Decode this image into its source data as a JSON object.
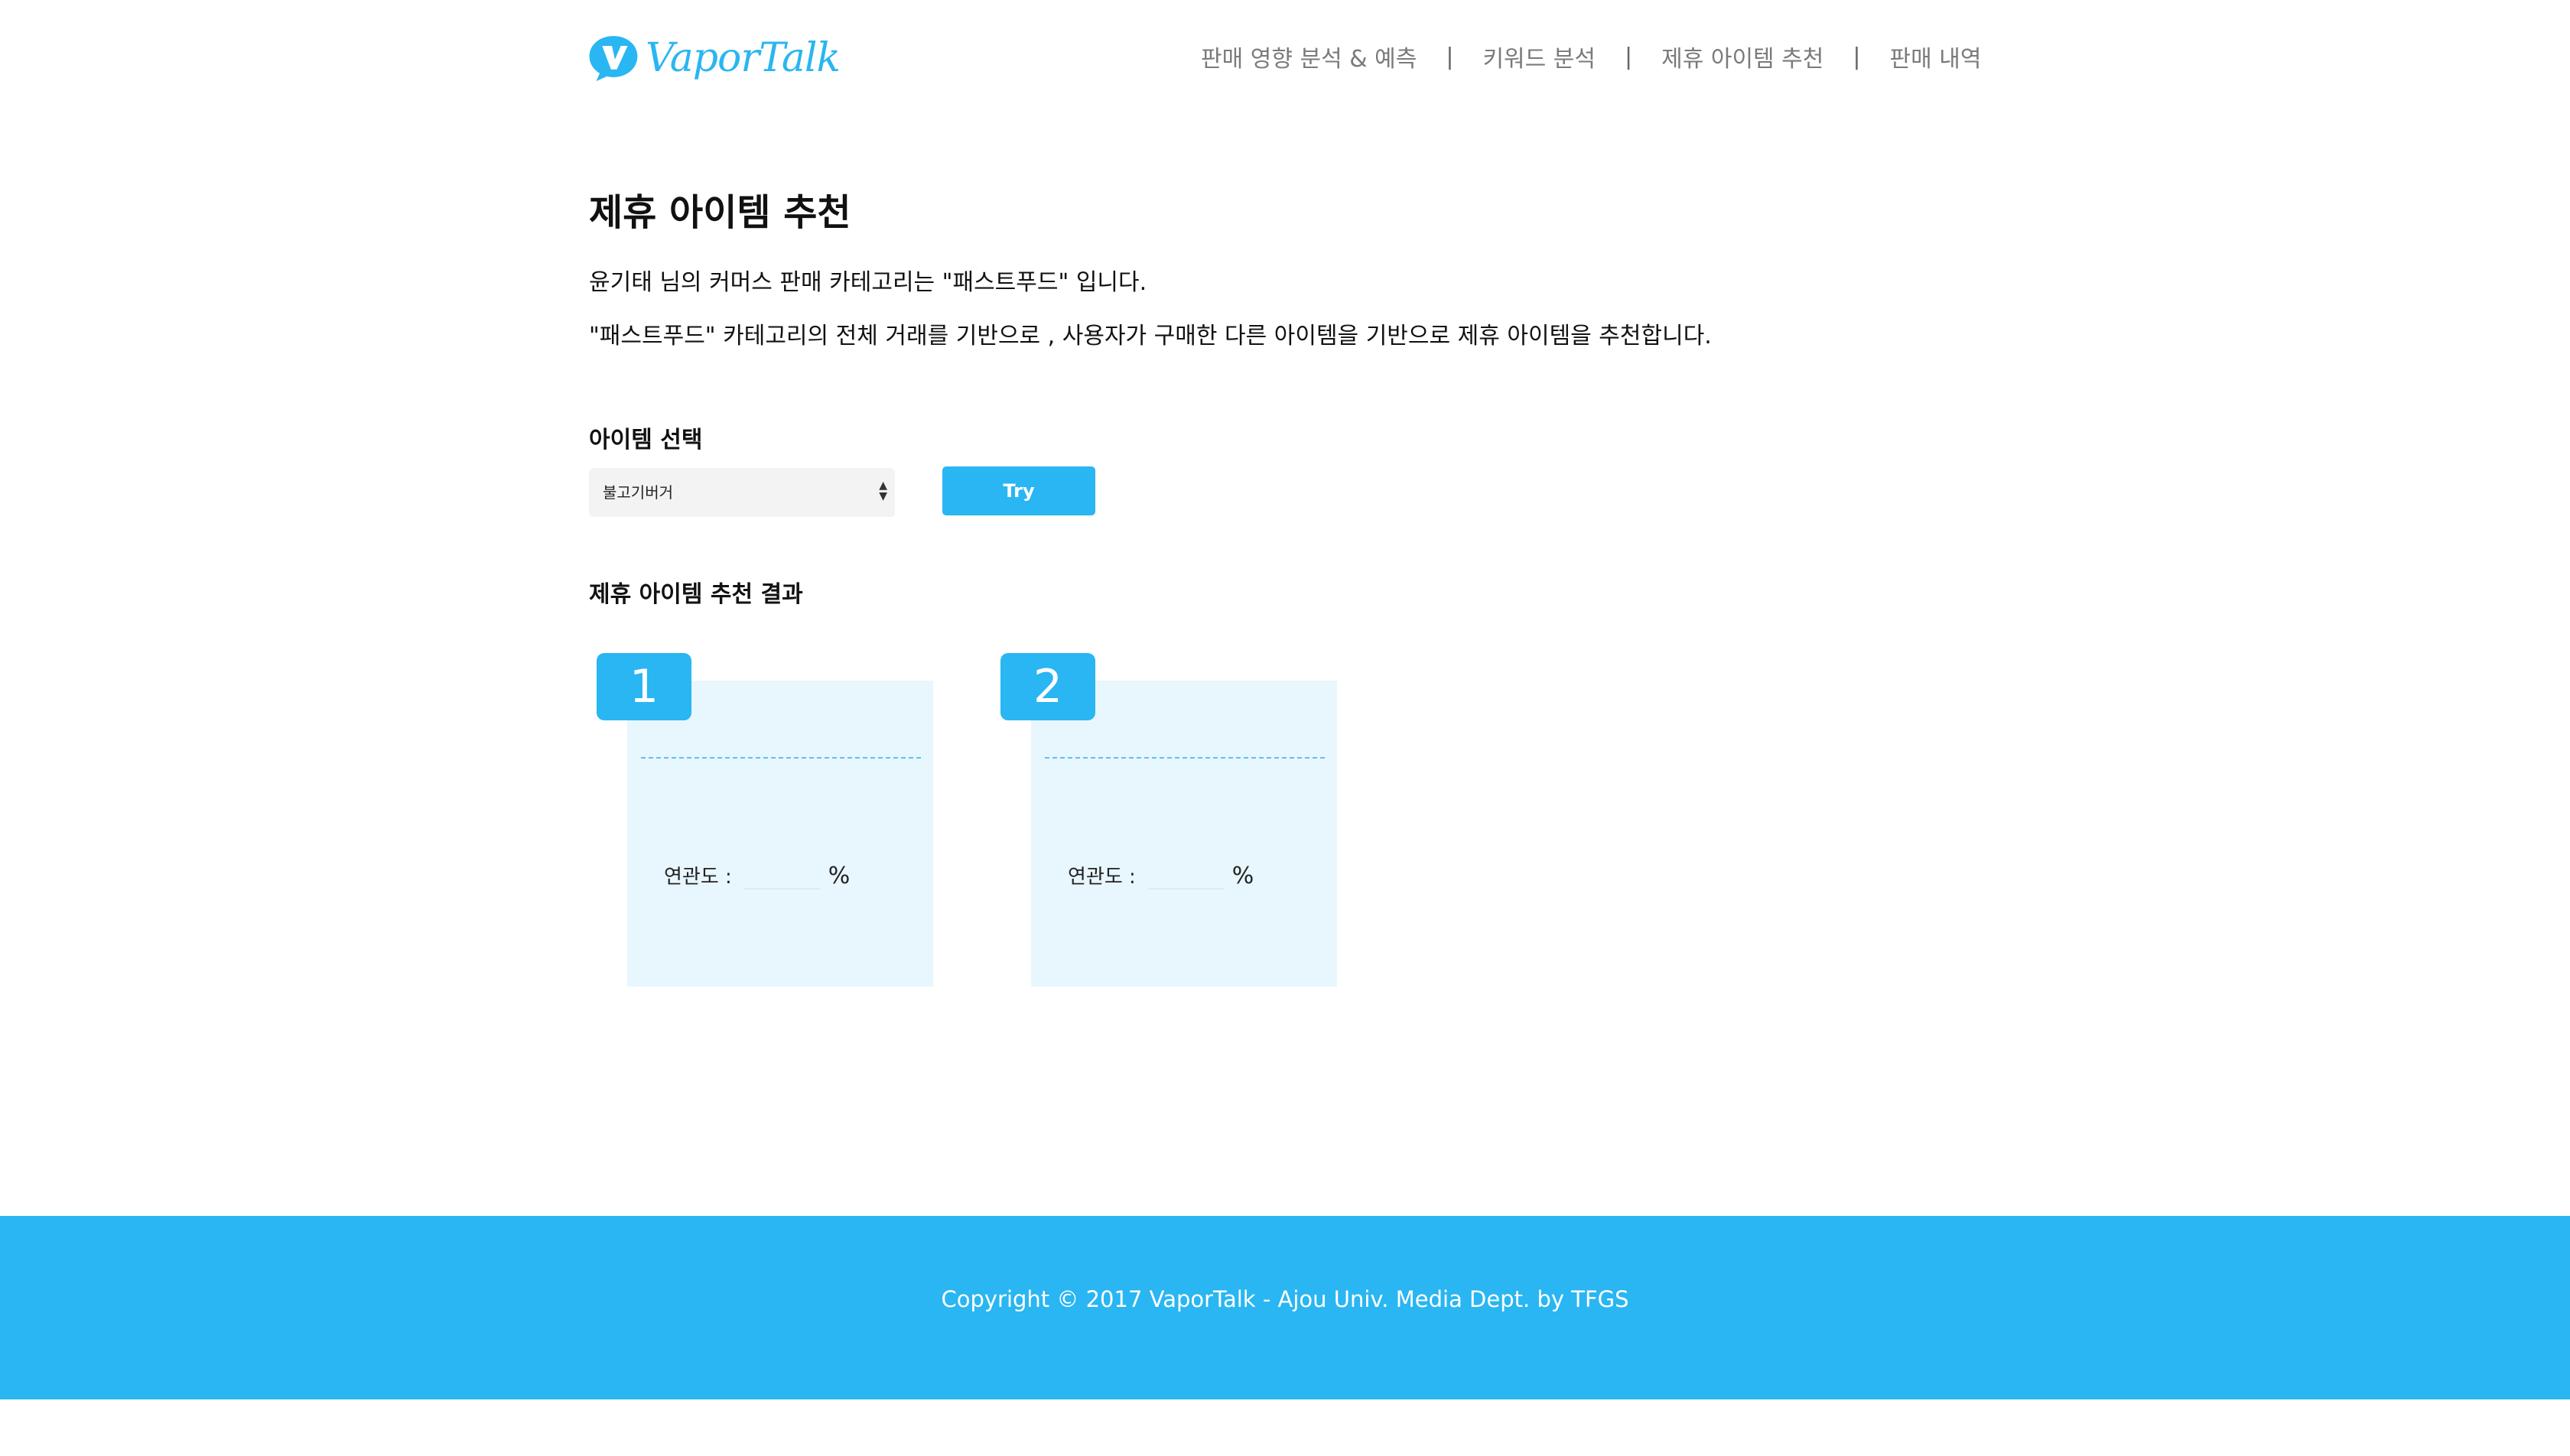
{
  "brand": {
    "name": "VaporTalk",
    "colors": {
      "accent": "#29b6f2",
      "card_bg": "#e8f6fd",
      "footer_bg": "#29b6f2"
    }
  },
  "nav": {
    "items": [
      {
        "label": "판매 영향 분석 & 예측"
      },
      {
        "label": "키워드 분석"
      },
      {
        "label": "제휴 아이템 추천"
      },
      {
        "label": "판매 내역"
      }
    ],
    "separator": "|"
  },
  "main": {
    "title": "제휴 아이템 추천",
    "desc1": "윤기태 님의 커머스 판매 카테고리는 \"패스트푸드\" 입니다.",
    "desc2": "\"패스트푸드\" 카테고리의 전체 거래를 기반으로 , 사용자가 구매한 다른 아이템을 기반으로 제휴 아이템을 추천합니다."
  },
  "selection": {
    "label": "아이템 선택",
    "selected_value": "불고기버거",
    "try_label": "Try"
  },
  "results": {
    "label": "제휴 아이템 추천 결과",
    "cards": [
      {
        "rank": "1",
        "relevance_label": "연관도 :",
        "relevance_value": "",
        "unit": "%"
      },
      {
        "rank": "2",
        "relevance_label": "연관도 :",
        "relevance_value": "",
        "unit": "%"
      }
    ]
  },
  "footer": {
    "copyright": "Copyright © 2017 VaporTalk - Ajou Univ. Media Dept. by TFGS"
  }
}
